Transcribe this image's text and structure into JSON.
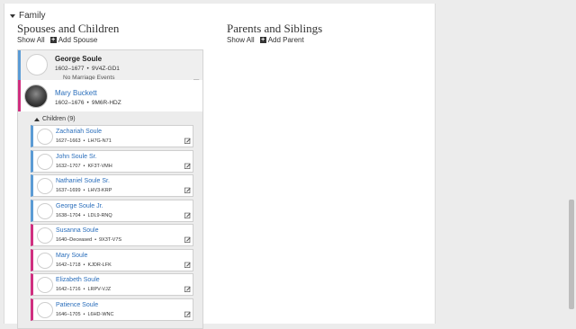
{
  "family": {
    "label": "Family"
  },
  "spouses": {
    "title": "Spouses and Children",
    "show_all": "Show All",
    "add": "Add Spouse"
  },
  "parents": {
    "title": "Parents and Siblings",
    "show_all": "Show All",
    "add": "Add Parent"
  },
  "husband": {
    "name": "George Soule",
    "years": "1602–1677",
    "id": "9V4Z-GD1"
  },
  "marriage": {
    "text": "No Marriage Events"
  },
  "wife": {
    "name": "Mary Buckett",
    "years": "1602–1676",
    "id": "9M6R-HDZ"
  },
  "children": {
    "toggle": "Children (9)",
    "items": [
      {
        "name": "Zachariah Soule",
        "years": "1627–1663",
        "id": "LH7G-N71",
        "gender": "male"
      },
      {
        "name": "John Soule Sr.",
        "years": "1632–1707",
        "id": "KF3T-VMH",
        "gender": "male"
      },
      {
        "name": "Nathaniel Soule Sr.",
        "years": "1637–1699",
        "id": "LHV3-KRP",
        "gender": "male"
      },
      {
        "name": "George Soule Jr.",
        "years": "1638–1704",
        "id": "LDL9-RNQ",
        "gender": "male"
      },
      {
        "name": "Susanna Soule",
        "years": "1640–Deceased",
        "id": "9X3T-V7S",
        "gender": "female"
      },
      {
        "name": "Mary Soule",
        "years": "1642–1718",
        "id": "KJDR-LFK",
        "gender": "female"
      },
      {
        "name": "Elizabeth Soule",
        "years": "1642–1716",
        "id": "LRPV-VJZ",
        "gender": "female"
      },
      {
        "name": "Patience Soule",
        "years": "1646–1705",
        "id": "L6HD-WNC",
        "gender": "female"
      }
    ]
  },
  "icons": {
    "caret": "caret-down-icon",
    "plus": "plus-icon",
    "edit": "edit-icon",
    "person": "person-icon"
  },
  "colors": {
    "male": "#5b9bd5",
    "female": "#d02f80",
    "link": "#2a6ebb"
  }
}
